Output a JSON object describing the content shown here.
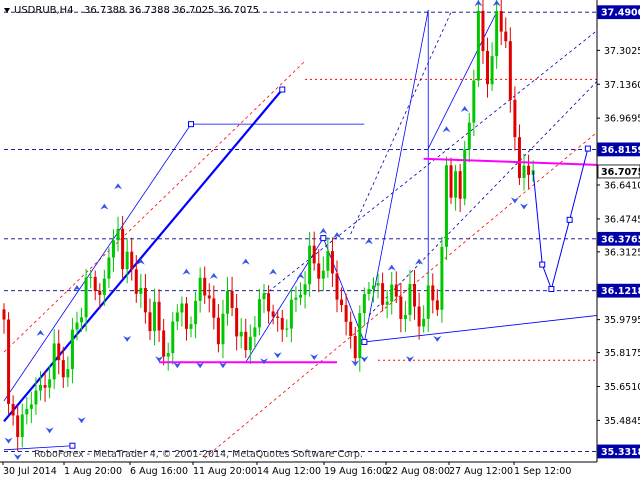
{
  "header": {
    "symbol_label": "USDRUB,H4",
    "ohlc_text": "36.7388 36.7388 36.7025 36.7075"
  },
  "watermark": "RoboForex - MetaTrader 4, © 2001-2014, MetaQuotes Software Corp.",
  "colors": {
    "background": "#ffffff",
    "bull_candle": "#00c800",
    "bear_candle": "#e00000",
    "axis_badge": "#0000aa",
    "trend_line": "#0000ff",
    "support_line": "#ff00ff",
    "channel_dashed": "#ff0000",
    "fractal_arrow": "#3355ee"
  },
  "chart_data": {
    "type": "candlestick",
    "symbol": "USDRUB",
    "timeframe": "H4",
    "last_close": 36.7075,
    "y_axis": {
      "range": [
        35.28,
        37.55
      ],
      "ticks": [
        "37.3025",
        "37.1360",
        "36.9695",
        "36.6410",
        "36.4745",
        "36.3125",
        "35.9795",
        "35.8175",
        "35.6510",
        "35.4845"
      ],
      "badges": [
        {
          "label": "37.4900",
          "value": 37.49,
          "style": "highlight"
        },
        {
          "label": "36.8159",
          "value": 36.8159,
          "style": "highlight"
        },
        {
          "label": "36.7075",
          "value": 36.7075,
          "style": "current"
        },
        {
          "label": "36.3765",
          "value": 36.3765,
          "style": "highlight"
        },
        {
          "label": "36.1218",
          "value": 36.1218,
          "style": "highlight"
        },
        {
          "label": "35.3318",
          "value": 35.3318,
          "style": "highlight"
        }
      ]
    },
    "x_axis": {
      "labels": [
        "30 Jul 2014",
        "1 Aug 20:00",
        "6 Aug 16:00",
        "11 Aug 20:00",
        "14 Aug 12:00",
        "19 Aug 16:00",
        "22 Aug 08:00",
        "27 Aug 12:00",
        "1 Sep 12:00"
      ]
    },
    "price_path": [
      [
        0,
        35.96
      ],
      [
        1,
        35.55
      ],
      [
        3,
        35.45
      ],
      [
        5,
        35.52
      ],
      [
        7,
        35.65
      ],
      [
        9,
        35.62
      ],
      [
        11,
        35.85
      ],
      [
        13,
        35.68
      ],
      [
        15,
        35.9
      ],
      [
        17,
        36.0
      ],
      [
        18,
        36.22
      ],
      [
        20,
        36.1
      ],
      [
        22,
        36.18
      ],
      [
        24,
        36.35
      ],
      [
        25,
        36.48
      ],
      [
        26,
        36.2
      ],
      [
        27,
        36.3
      ],
      [
        29,
        36.15
      ],
      [
        30,
        36.1
      ],
      [
        31,
        36.0
      ],
      [
        32,
        35.95
      ],
      [
        33,
        36.08
      ],
      [
        34,
        35.9
      ],
      [
        35,
        35.78
      ],
      [
        37,
        35.95
      ],
      [
        39,
        36.05
      ],
      [
        41,
        35.92
      ],
      [
        43,
        36.2
      ],
      [
        45,
        36.05
      ],
      [
        47,
        35.9
      ],
      [
        49,
        36.1
      ],
      [
        51,
        35.95
      ],
      [
        53,
        35.82
      ],
      [
        55,
        35.98
      ],
      [
        57,
        36.1
      ],
      [
        59,
        36.0
      ],
      [
        61,
        35.92
      ],
      [
        63,
        36.05
      ],
      [
        65,
        36.1
      ],
      [
        67,
        36.3
      ],
      [
        69,
        36.2
      ],
      [
        71,
        36.28
      ],
      [
        73,
        36.12
      ],
      [
        75,
        35.95
      ],
      [
        77,
        35.84
      ],
      [
        79,
        36.1
      ],
      [
        81,
        36.18
      ],
      [
        83,
        36.05
      ],
      [
        85,
        36.15
      ],
      [
        87,
        35.98
      ],
      [
        89,
        36.12
      ],
      [
        91,
        35.95
      ],
      [
        93,
        36.1
      ],
      [
        95,
        36.05
      ],
      [
        96,
        36.35
      ],
      [
        97,
        36.7
      ],
      [
        98,
        36.58
      ],
      [
        99,
        36.75
      ],
      [
        100,
        36.55
      ],
      [
        101,
        36.8
      ],
      [
        102,
        36.95
      ],
      [
        103,
        37.2
      ],
      [
        104,
        37.45
      ],
      [
        105,
        37.3
      ],
      [
        106,
        37.15
      ],
      [
        107,
        37.3
      ],
      [
        108,
        37.45
      ],
      [
        109,
        37.4
      ],
      [
        110,
        37.38
      ],
      [
        111,
        37.05
      ],
      [
        112,
        36.85
      ],
      [
        113,
        36.68
      ],
      [
        114,
        36.78
      ],
      [
        115,
        36.65
      ],
      [
        116,
        36.71
      ]
    ],
    "forecast_path": [
      [
        116,
        36.71
      ],
      [
        118,
        36.25
      ],
      [
        120,
        36.13
      ],
      [
        124,
        36.47
      ],
      [
        128,
        36.82
      ]
    ],
    "fractals": {
      "up": [
        [
          8,
          35.9
        ],
        [
          16,
          36.12
        ],
        [
          22,
          36.52
        ],
        [
          25,
          36.62
        ],
        [
          30,
          36.25
        ],
        [
          40,
          36.2
        ],
        [
          46,
          36.18
        ],
        [
          53,
          36.25
        ],
        [
          59,
          36.2
        ],
        [
          65,
          36.18
        ],
        [
          70,
          36.4
        ],
        [
          73,
          36.38
        ],
        [
          80,
          36.35
        ],
        [
          85,
          36.22
        ],
        [
          91,
          36.25
        ],
        [
          97,
          36.9
        ],
        [
          101,
          37.0
        ],
        [
          104,
          37.52
        ],
        [
          108,
          37.52
        ]
      ],
      "down": [
        [
          1,
          35.4
        ],
        [
          3,
          35.32
        ],
        [
          10,
          35.45
        ],
        [
          17,
          35.5
        ],
        [
          27,
          35.9
        ],
        [
          34,
          35.8
        ],
        [
          38,
          35.77
        ],
        [
          43,
          35.77
        ],
        [
          48,
          35.77
        ],
        [
          57,
          35.79
        ],
        [
          60,
          35.82
        ],
        [
          68,
          35.81
        ],
        [
          77,
          35.78
        ],
        [
          79,
          35.8
        ],
        [
          89,
          35.8
        ],
        [
          95,
          35.9
        ],
        [
          112,
          36.58
        ],
        [
          114,
          36.55
        ]
      ]
    },
    "horizontal_levels": [
      {
        "value": 37.49,
        "style": "dashed",
        "color": "#000088",
        "from": 0,
        "to": 130
      },
      {
        "value": 36.8159,
        "style": "dashed",
        "color": "#000088",
        "from": 0,
        "to": 130
      },
      {
        "value": 36.3765,
        "style": "dashed",
        "color": "#000088",
        "from": 0,
        "to": 130
      },
      {
        "value": 36.1218,
        "style": "dashed",
        "color": "#000088",
        "from": 0,
        "to": 130
      },
      {
        "value": 35.3318,
        "style": "dashed",
        "color": "#000088",
        "from": 0,
        "to": 130
      },
      {
        "value": 37.16,
        "style": "dotted-red",
        "color": "#ff0000",
        "from": 66,
        "to": 130
      },
      {
        "value": 35.78,
        "style": "dotted-red",
        "color": "#ff0000",
        "from": 82,
        "to": 130
      }
    ],
    "trend_lines": [
      {
        "from": [
          0,
          35.48
        ],
        "to": [
          61,
          37.11
        ],
        "color": "#0000ff",
        "width": 2.2
      },
      {
        "from": [
          0,
          35.58
        ],
        "to": [
          41,
          36.94
        ],
        "color": "#0000ff",
        "width": 0.8
      },
      {
        "from": [
          41,
          36.94
        ],
        "to": [
          79,
          36.94
        ],
        "color": "#0000ff",
        "width": 0.8
      },
      {
        "from": [
          0,
          35.34
        ],
        "to": [
          15,
          35.36
        ],
        "color": "#0000ff",
        "width": 0.8
      },
      {
        "from": [
          53,
          35.77
        ],
        "to": [
          70,
          36.38
        ],
        "color": "#0000ff",
        "width": 0.8
      },
      {
        "from": [
          70,
          36.38
        ],
        "to": [
          79,
          35.87
        ],
        "color": "#0000ff",
        "width": 0.8
      },
      {
        "from": [
          79,
          35.87
        ],
        "to": [
          93,
          37.5
        ],
        "color": "#0000ff",
        "width": 0.8
      },
      {
        "from": [
          79,
          35.87
        ],
        "to": [
          130,
          36.0
        ],
        "color": "#0000ff",
        "width": 0.9
      },
      {
        "from": [
          93,
          37.5
        ],
        "to": [
          93,
          36.12
        ],
        "color": "#0000ff",
        "width": 0.8
      },
      {
        "from": [
          93,
          36.82
        ],
        "to": [
          108,
          37.49
        ],
        "color": "#0000ff",
        "width": 0.8
      }
    ],
    "support_lines": [
      {
        "from": [
          34,
          35.77
        ],
        "to": [
          73,
          35.77
        ]
      },
      {
        "from": [
          92,
          36.77
        ],
        "to": [
          130,
          36.74
        ]
      }
    ],
    "channel_lines": [
      {
        "from": [
          0,
          35.82
        ],
        "to": [
          66,
          37.25
        ],
        "color": "#ff0000"
      },
      {
        "from": [
          44,
          35.3
        ],
        "to": [
          130,
          36.9
        ],
        "color": "#ff0000"
      },
      {
        "from": [
          57,
          36.1
        ],
        "to": [
          130,
          37.4
        ],
        "color": "#0000aa"
      },
      {
        "from": [
          76,
          36.4
        ],
        "to": [
          98,
          37.49
        ],
        "color": "#0000aa"
      },
      {
        "from": [
          80,
          36.0
        ],
        "to": [
          130,
          37.15
        ],
        "color": "#0000aa"
      }
    ]
  }
}
